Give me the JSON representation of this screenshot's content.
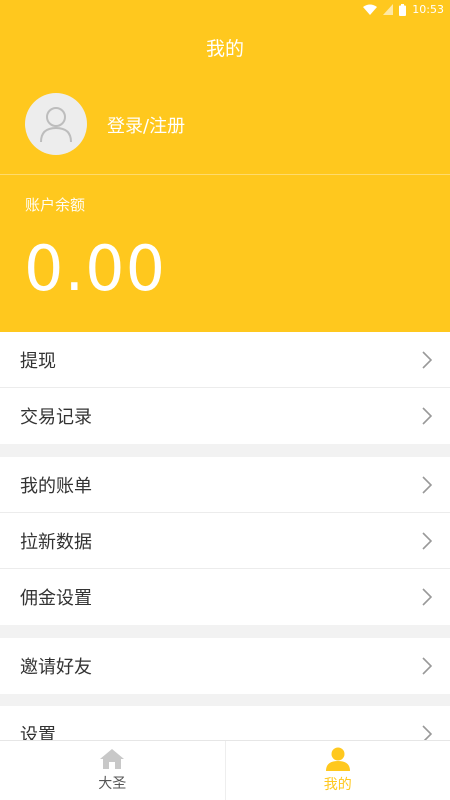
{
  "status_bar": {
    "time": "10:53"
  },
  "header": {
    "title": "我的",
    "login_text": "登录/注册",
    "balance_label": "账户余额",
    "balance_value": "0.00"
  },
  "menu": {
    "group1": [
      {
        "label": "提现"
      },
      {
        "label": "交易记录"
      }
    ],
    "group2": [
      {
        "label": "我的账单"
      },
      {
        "label": "拉新数据"
      },
      {
        "label": "佣金设置"
      }
    ],
    "group3": [
      {
        "label": "邀请好友"
      }
    ],
    "group4": [
      {
        "label": "设置"
      }
    ]
  },
  "tabbar": {
    "tabs": [
      {
        "label": "大圣",
        "icon": "home-icon"
      },
      {
        "label": "我的",
        "icon": "user-icon",
        "active": true
      }
    ]
  },
  "colors": {
    "accent": "#ffc81e",
    "text": "#333333",
    "bg": "#f2f2f2"
  }
}
